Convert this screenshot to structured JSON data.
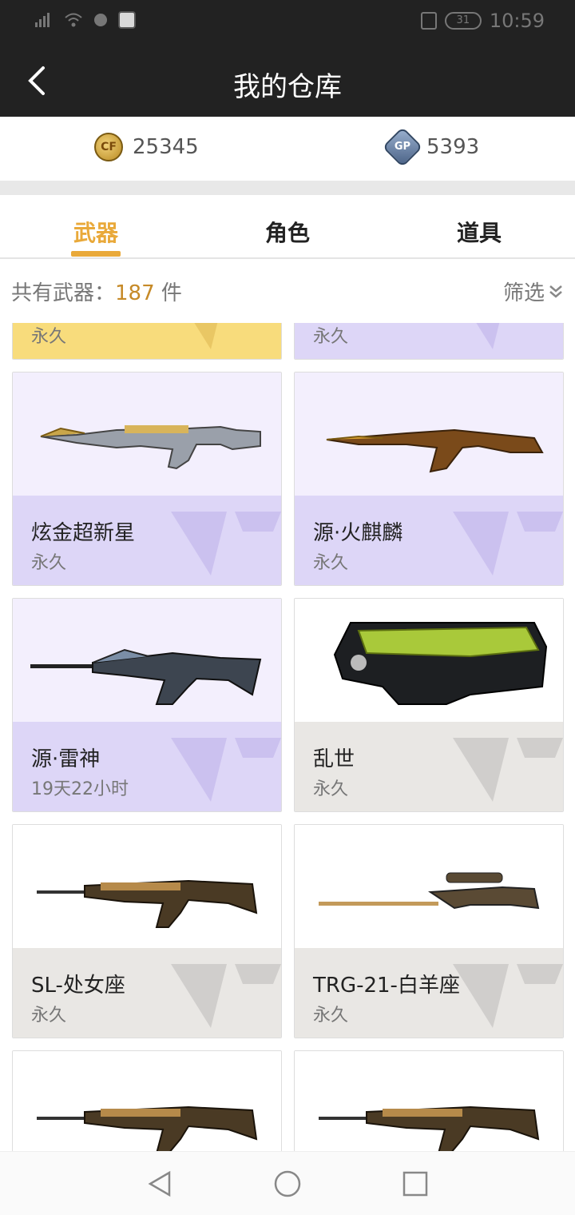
{
  "status_bar": {
    "signal": "46",
    "battery": "31",
    "time": "10:59"
  },
  "header": {
    "title": "我的仓库"
  },
  "currency": {
    "coins": {
      "icon": "cf-coin-icon",
      "value": "25345"
    },
    "gp": {
      "icon": "gp-icon",
      "badge": "GP",
      "value": "5393"
    }
  },
  "tabs": [
    {
      "label": "武器",
      "active": true
    },
    {
      "label": "角色",
      "active": false
    },
    {
      "label": "道具",
      "active": false
    }
  ],
  "summary": {
    "label": "共有武器：",
    "count": "187",
    "unit": "件"
  },
  "filter": {
    "label": "筛选"
  },
  "items": [
    {
      "name": "",
      "duration": "永久",
      "tier": "gold"
    },
    {
      "name": "",
      "duration": "永久",
      "tier": "purple"
    },
    {
      "name": "炫金超新星",
      "duration": "永久",
      "tier": "purple"
    },
    {
      "name": "源·火麒麟",
      "duration": "永久",
      "tier": "purple"
    },
    {
      "name": "源·雷神",
      "duration": "19天22小时",
      "tier": "purple"
    },
    {
      "name": "乱世",
      "duration": "永久",
      "tier": "gray"
    },
    {
      "name": "SL-处女座",
      "duration": "永久",
      "tier": "gray"
    },
    {
      "name": "TRG-21-白羊座",
      "duration": "永久",
      "tier": "gray"
    },
    {
      "name": "",
      "duration": "",
      "tier": "gray"
    },
    {
      "name": "",
      "duration": "",
      "tier": "gray"
    }
  ],
  "colors": {
    "accent": "#e9a93a",
    "gold_card": "#f8dc7c",
    "purple_card_top": "#f3effd",
    "purple_card_bottom": "#ddd6f7",
    "gray_card_bottom": "#e9e7e4"
  }
}
